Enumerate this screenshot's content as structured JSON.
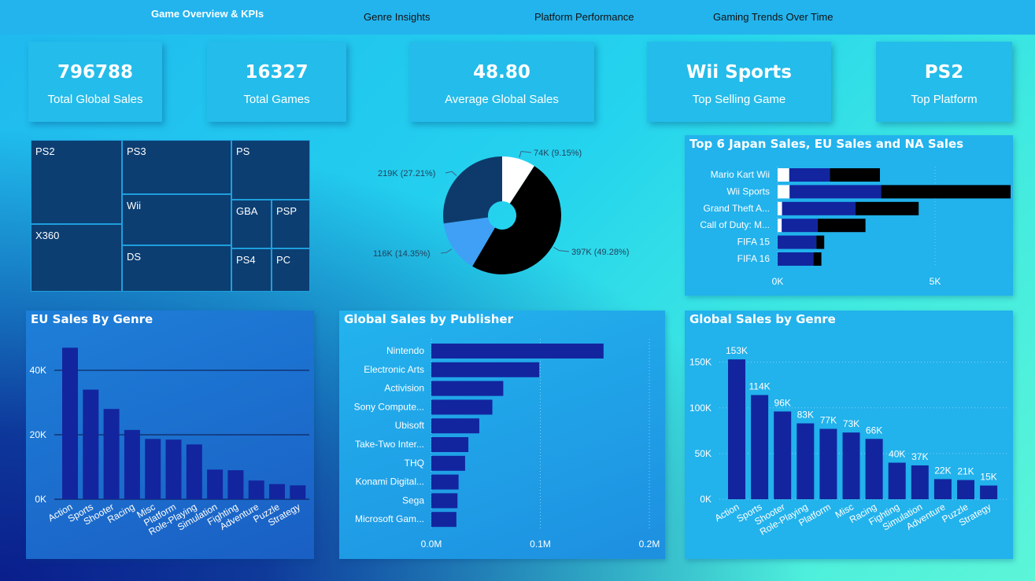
{
  "nav": {
    "tabs": [
      "Game Overview & KPIs",
      "Genre Insights",
      "Platform Performance",
      "Gaming Trends Over Time"
    ]
  },
  "kpis": [
    {
      "value": "796788",
      "label": "Total Global Sales"
    },
    {
      "value": "16327",
      "label": "Total Games"
    },
    {
      "value": "48.80",
      "label": "Average Global Sales"
    },
    {
      "value": "Wii Sports",
      "label": "Top Selling Game"
    },
    {
      "value": "PS2",
      "label": "Top Platform"
    }
  ],
  "colors": {
    "bar": "#12259e",
    "panel": "#22b2ec",
    "treemap_cell": "#0c3e72",
    "pie": [
      "#ffffff",
      "#000000",
      "#3fa0f5",
      "#0e3a6b"
    ]
  },
  "treemap": {
    "platforms": [
      "PS2",
      "PS3",
      "PS",
      "X360",
      "Wii",
      "GBA",
      "PSP",
      "DS",
      "PS4",
      "PC"
    ]
  },
  "chart_data": [
    {
      "type": "pie",
      "donut": true,
      "slices": [
        {
          "label": "74K (9.15%)",
          "value": 74,
          "color": "#ffffff"
        },
        {
          "label": "397K (49.28%)",
          "value": 397,
          "color": "#000000"
        },
        {
          "label": "116K (14.35%)",
          "value": 116,
          "color": "#3fa0f5"
        },
        {
          "label": "219K (27.21%)",
          "value": 219,
          "color": "#0e3a6b"
        }
      ]
    },
    {
      "type": "bar",
      "orientation": "horizontal",
      "stacked": true,
      "title": "Top 6 Japan Sales, EU Sales and NA Sales",
      "categories": [
        "Mario Kart Wii",
        "Wii Sports",
        "Grand Theft A...",
        "Call of Duty: M...",
        "FIFA 15",
        "FIFA 16"
      ],
      "series": [
        {
          "values": [
            370,
            380,
            140,
            130,
            0,
            0
          ],
          "color": "#ffffff"
        },
        {
          "values": [
            1290,
            2910,
            2330,
            1140,
            1230,
            1140
          ],
          "color": "#12259e"
        },
        {
          "values": [
            1590,
            4110,
            2010,
            1520,
            250,
            250
          ],
          "color": "#000000"
        }
      ],
      "xticks": [
        "0K",
        "5K"
      ],
      "xlim": [
        0,
        7500
      ]
    },
    {
      "type": "bar",
      "title": "EU Sales By Genre",
      "categories": [
        "Action",
        "Sports",
        "Shooter",
        "Racing",
        "Misc",
        "Platform",
        "Role-Playing",
        "Simulation",
        "Fighting",
        "Adventure",
        "Puzzle",
        "Strategy"
      ],
      "values": [
        47000,
        34000,
        28000,
        21500,
        18700,
        18500,
        17000,
        9200,
        9000,
        5800,
        4700,
        4300
      ],
      "yticks": [
        "0K",
        "20K",
        "40K"
      ],
      "ylim": [
        0,
        50000
      ]
    },
    {
      "type": "bar",
      "orientation": "horizontal",
      "title": "Global Sales by Publisher",
      "categories": [
        "Nintendo",
        "Electronic Arts",
        "Activision",
        "Sony Compute...",
        "Ubisoft",
        "Take-Two Inter...",
        "THQ",
        "Konami Digital...",
        "Sega",
        "Microsoft Gam..."
      ],
      "values": [
        158000,
        99000,
        66000,
        56000,
        44000,
        34000,
        31000,
        25000,
        24000,
        23000
      ],
      "xticks": [
        "0.0M",
        "0.1M",
        "0.2M"
      ],
      "xlim": [
        0,
        200000
      ]
    },
    {
      "type": "bar",
      "title": "Global Sales by Genre",
      "categories": [
        "Action",
        "Sports",
        "Shooter",
        "Role-Playing",
        "Platform",
        "Misc",
        "Racing",
        "Fighting",
        "Simulation",
        "Adventure",
        "Puzzle",
        "Strategy"
      ],
      "values": [
        153,
        114,
        96,
        83,
        77,
        73,
        66,
        40,
        37,
        22,
        21,
        15
      ],
      "data_labels": [
        "153K",
        "114K",
        "96K",
        "83K",
        "77K",
        "73K",
        "66K",
        "40K",
        "37K",
        "22K",
        "21K",
        "15K"
      ],
      "yticks": [
        "0K",
        "50K",
        "100K",
        "150K"
      ],
      "ylim": [
        0,
        160
      ]
    }
  ]
}
